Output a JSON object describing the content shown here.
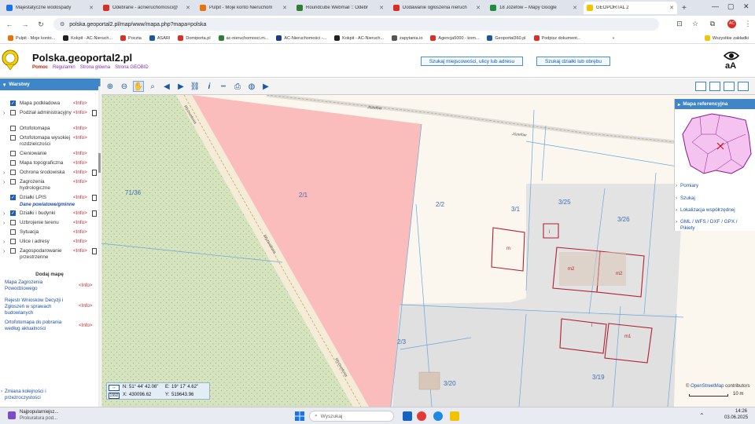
{
  "browser": {
    "tabs": [
      {
        "label": "Majestatyczne wodospady",
        "color": "#1a73e8"
      },
      {
        "label": "Odebrane - acnieruchomosci@",
        "color": "#d93025"
      },
      {
        "label": "Pulpit - Moje konto Nieruchom",
        "color": "#e8710a"
      },
      {
        "label": "Roundcube Webmail :: Odebr",
        "color": "#2e7d32"
      },
      {
        "label": "Dodawanie ogłoszenia nieruch",
        "color": "#d93025"
      },
      {
        "label": "18 Józefów – Mapy Google",
        "color": "#1e8e3e"
      },
      {
        "label": "GEOPORTAL 2",
        "color": "#f2c400"
      }
    ],
    "url": "polska.geoportal2.pl/map/www/mapa.php?mapa=polska",
    "bookmarks": [
      "Pulpit - Moje konto...",
      "Kokpit - AC-Nieruch...",
      "Poczta",
      "ASARI",
      "Domiporta.pl",
      "ac-nieruchomosci.m...",
      "AC-Nieruchomości -...",
      "Kokpit - AC-Nieruch...",
      "zapytania.io",
      "Agencja5000 - kom...",
      "Geoportal360.pl",
      "Podpisz dokument...",
      "»",
      "Wszystkie zakładki"
    ]
  },
  "header": {
    "title": "Polska.geoportal2.pl",
    "links": [
      "Pomoc",
      "Regulamin",
      "Strona główna",
      "Strona GEOBID"
    ],
    "search_btn1": "Szukaj miejscowości, ulicy lub adresu",
    "search_btn2": "Szukaj działki lub obrębu",
    "font_btn": "aA"
  },
  "left_panel": {
    "title": "Warstwy",
    "layers": [
      {
        "label": "Mapa podkładowa",
        "checked": true,
        "arrow": false,
        "doc": false
      },
      {
        "label": "Podział administracyjny",
        "checked": false,
        "arrow": true,
        "doc": true
      },
      {
        "label": "Ortofotomapa",
        "checked": false,
        "arrow": false,
        "doc": false
      },
      {
        "label": "Ortofotomapa wysokiej rozdzielczości",
        "checked": false,
        "arrow": false,
        "doc": false
      },
      {
        "label": "Cieniowanie",
        "checked": false,
        "arrow": false,
        "doc": false
      },
      {
        "label": "Mapa topograficzna",
        "checked": false,
        "arrow": false,
        "doc": false
      },
      {
        "label": "Ochrona środowiska",
        "checked": false,
        "arrow": true,
        "doc": true
      },
      {
        "label": "Zagrożenia hydrologiczne",
        "checked": false,
        "arrow": true,
        "doc": false
      },
      {
        "label": "Działki LPIS",
        "checked": true,
        "arrow": false,
        "doc": true
      },
      {
        "label": "Działki i budynki",
        "checked": true,
        "arrow": true,
        "doc": true
      },
      {
        "label": "Uzbrojenie terenu",
        "checked": false,
        "arrow": true,
        "doc": false
      },
      {
        "label": "Sytuacja",
        "checked": false,
        "arrow": false,
        "doc": false
      },
      {
        "label": "Ulice i adresy",
        "checked": false,
        "arrow": true,
        "doc": false
      },
      {
        "label": "Zagospodarowanie przestrzenne",
        "checked": false,
        "arrow": true,
        "doc": true
      }
    ],
    "info_label": "<Info>",
    "subheading": "Dane powiatowe/gminne",
    "add_map": "Dodaj mapę",
    "extras": [
      "Mapa Zagrożenia Powodziowego",
      "Rejestr Wniosków Decyzji i Zgłoszeń w sprawach budowlanych",
      "Ortofotomapa do pobrania według aktualności"
    ],
    "order_link": "Zmiana kolejności i przezroczystości"
  },
  "reference": {
    "title": "Mapa referencyjna",
    "links": [
      "Pomiary",
      "Szukaj",
      "Lokalizacja współrzędnej",
      "GML / WFS / DXF / GPX / Pikiety"
    ]
  },
  "map": {
    "parcels": [
      "71/36",
      "2/1",
      "2/2",
      "3/1",
      "3/25",
      "3/26",
      "2/3",
      "3/20",
      "3/19"
    ],
    "buildings": [
      "m",
      "i",
      "m2",
      "m2",
      "i",
      "m1"
    ],
    "streets": [
      "Wyzwolenia",
      "Józefów",
      "Józefów",
      "Wyzwolenia"
    ],
    "coords": {
      "n_label": "N:",
      "n": "51° 44' 42.06\"",
      "e_label": "E:",
      "e": "19° 17' 4.62\"",
      "x_label": "X:",
      "x": "430096.62",
      "y_label": "Y:",
      "y": "519643.96",
      "system": "1992"
    },
    "attribution_prefix": "©",
    "attribution_link": "OpenStreetMap",
    "attribution_suffix": "contributors",
    "scale_label": "10 m"
  },
  "taskbar": {
    "news_title": "Najpopularniejsz...",
    "news_sub": "Prokuratura pod...",
    "search_placeholder": "Wyszukaj",
    "time": "14:26",
    "date": "03.06.2025"
  }
}
